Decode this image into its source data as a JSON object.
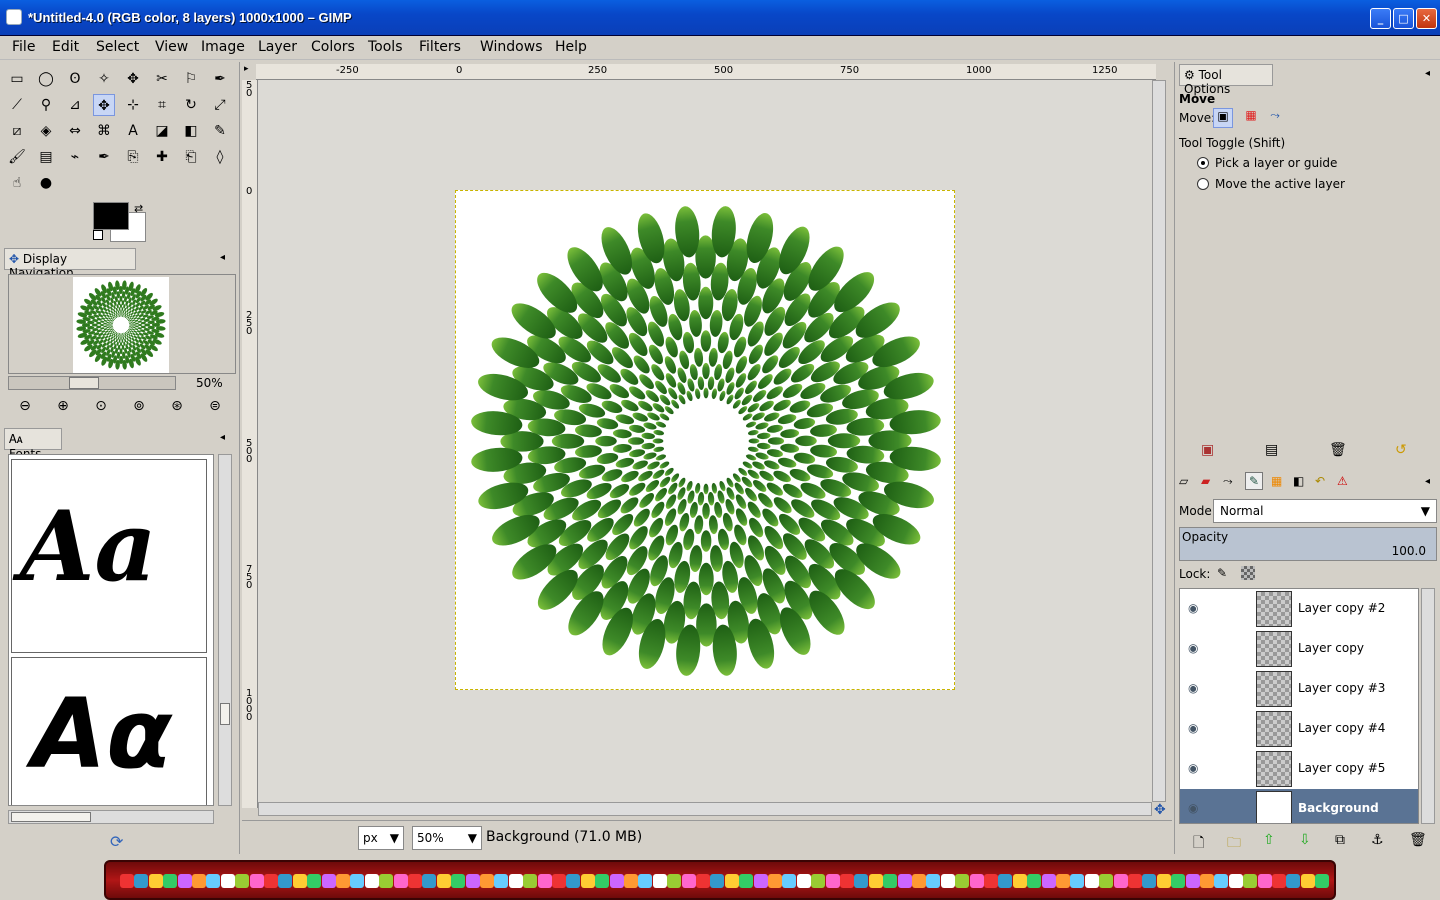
{
  "window": {
    "title": "*Untitled-4.0 (RGB color, 8 layers) 1000x1000 – GIMP"
  },
  "menu": [
    "File",
    "Edit",
    "Select",
    "View",
    "Image",
    "Layer",
    "Colors",
    "Tools",
    "Filters",
    "Windows",
    "Help"
  ],
  "toolbox": {
    "tools": [
      "rect-select",
      "ellipse-select",
      "free-select",
      "fuzzy-select",
      "select-by-color",
      "scissors",
      "foreground-select",
      "paths",
      "color-picker",
      "zoom",
      "measure",
      "move",
      "align",
      "crop",
      "rotate",
      "scale",
      "shear",
      "perspective",
      "flip",
      "cage",
      "text",
      "bucket-fill",
      "blend",
      "pencil",
      "paintbrush",
      "eraser",
      "airbrush",
      "ink",
      "clone",
      "heal",
      "perspective-clone",
      "blur",
      "smudge",
      "dodge-burn"
    ],
    "active_tool": "move",
    "fg_color": "#000000",
    "bg_color": "#ffffff"
  },
  "navigation": {
    "tab_label": "Display Navigation",
    "zoom_label": "50%"
  },
  "fonts": {
    "tab_label": "Fonts",
    "previews": [
      "Aa",
      "Aα"
    ]
  },
  "rulers": {
    "h": [
      "-250",
      "0",
      "250",
      "500",
      "750",
      "1000",
      "1250"
    ],
    "v": [
      "5\n0",
      "0",
      "2\n5\n0",
      "5\n0\n0",
      "7\n5\n0",
      "1\n0\n0\n0"
    ]
  },
  "status": {
    "unit": "px",
    "zoom": "50",
    "zoom_suffix": "%",
    "text": "Background (71.0 MB)"
  },
  "tool_options": {
    "tab_label": "Tool Options",
    "tool_name": "Move",
    "move_label": "Move:",
    "toggle_label": "Tool Toggle  (Shift)",
    "option1": "Pick a layer or guide",
    "option2": "Move the active layer"
  },
  "layers": {
    "mode_label": "Mode:",
    "mode_value": "Normal",
    "opacity_label": "Opacity",
    "opacity_value": "100.0",
    "lock_label": "Lock:",
    "items": [
      {
        "name": "Layer copy #2",
        "selected": false
      },
      {
        "name": "Layer copy",
        "selected": false
      },
      {
        "name": "Layer copy #3",
        "selected": false
      },
      {
        "name": "Layer copy #4",
        "selected": false
      },
      {
        "name": "Layer copy #5",
        "selected": false
      },
      {
        "name": "Background",
        "selected": true
      }
    ]
  },
  "colors": {
    "title_bar": "#0847c8",
    "leaf_green": "#2f7a1e",
    "selection": "#5a7394",
    "taskbar": "#b11616"
  }
}
